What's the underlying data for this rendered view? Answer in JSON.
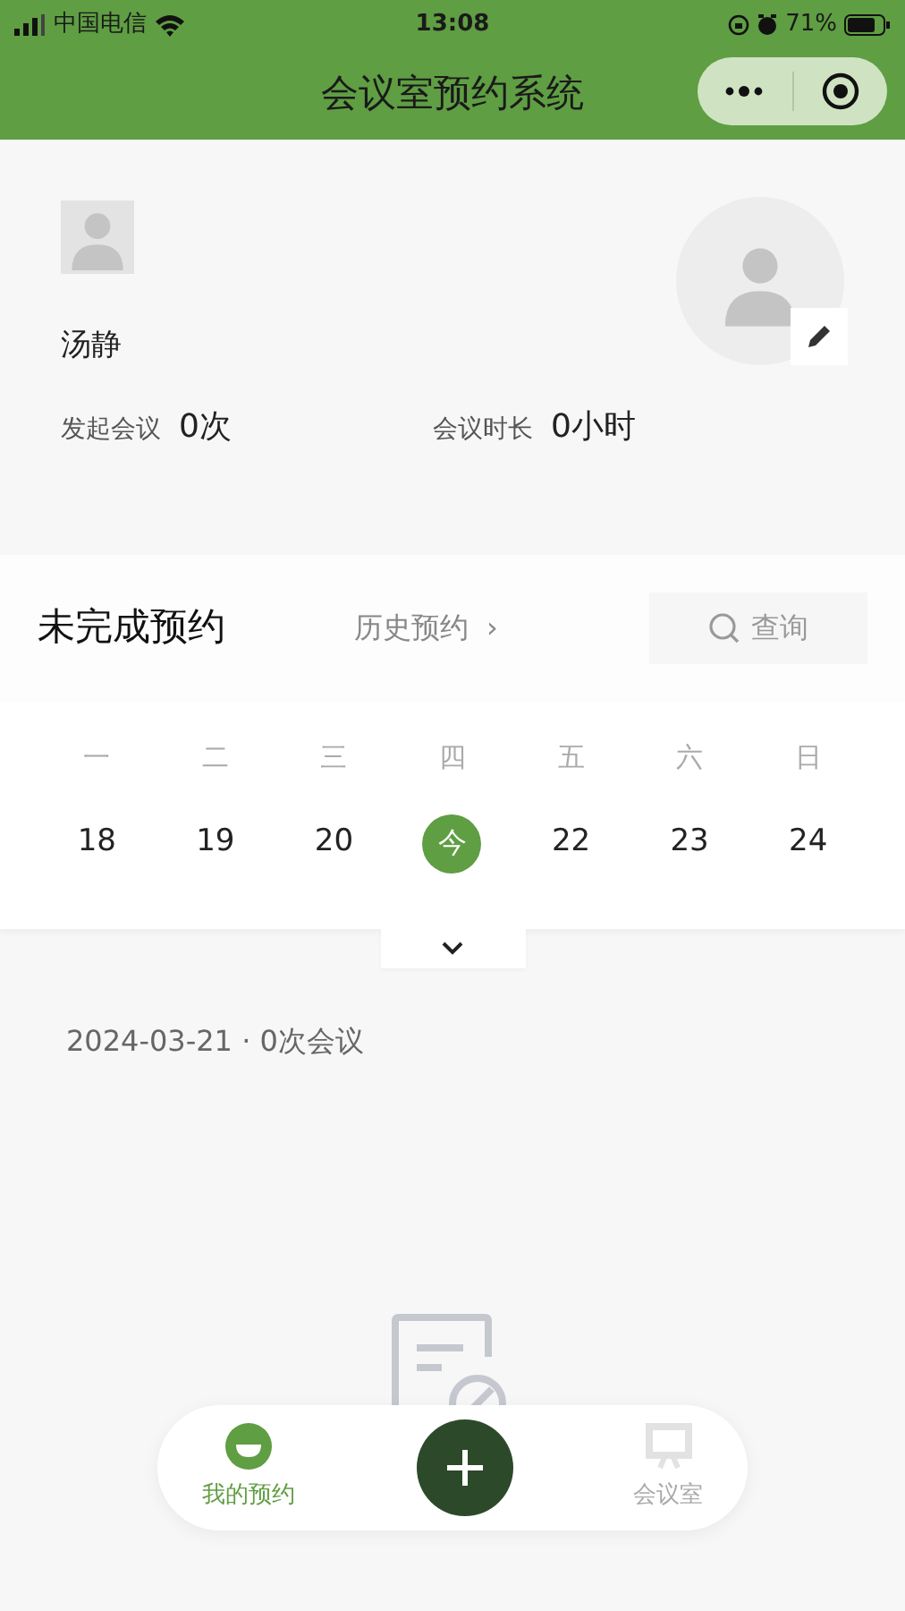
{
  "status_bar": {
    "carrier": "中国电信",
    "time": "13:08",
    "battery": "71%"
  },
  "nav": {
    "title": "会议室预约系统"
  },
  "profile": {
    "name": "汤静",
    "stats": [
      {
        "label": "发起会议",
        "value": "0次"
      },
      {
        "label": "会议时长",
        "value": "0小时"
      }
    ]
  },
  "section": {
    "title": "未完成预约",
    "history_link": "历史预约",
    "history_arrow": "›",
    "search_label": "查询"
  },
  "calendar": {
    "weekdays": [
      "一",
      "二",
      "三",
      "四",
      "五",
      "六",
      "日"
    ],
    "days": [
      {
        "label": "18",
        "selected": false
      },
      {
        "label": "19",
        "selected": false
      },
      {
        "label": "20",
        "selected": false
      },
      {
        "label": "今",
        "selected": true
      },
      {
        "label": "22",
        "selected": false
      },
      {
        "label": "23",
        "selected": false
      },
      {
        "label": "24",
        "selected": false
      }
    ]
  },
  "summary": "2024-03-21 · 0次会议",
  "tab_bar": [
    {
      "kind": "tab",
      "label": "我的预约",
      "selected": true
    },
    {
      "kind": "add"
    },
    {
      "kind": "tab",
      "label": "会议室",
      "selected": false
    }
  ]
}
